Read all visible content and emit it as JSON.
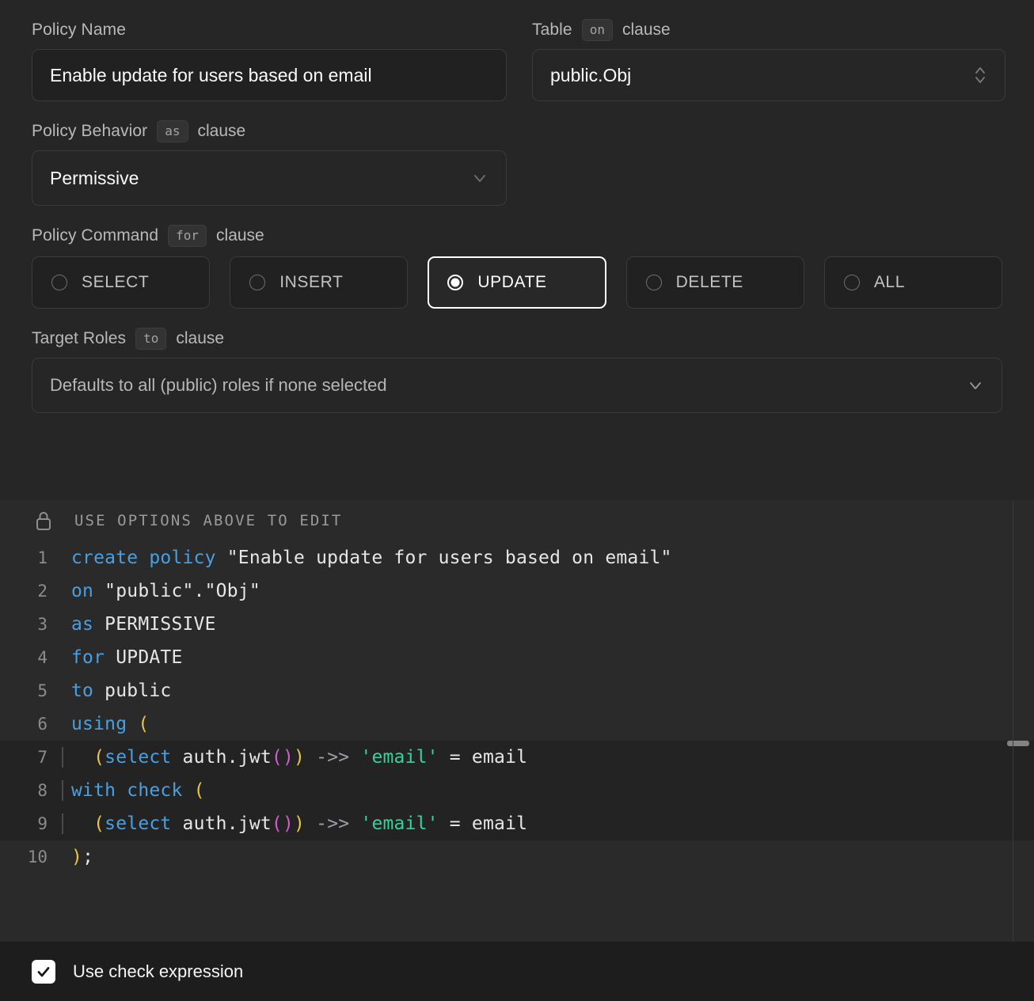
{
  "form": {
    "policy_name": {
      "label": "Policy Name",
      "value": "Enable update for users based on email",
      "placeholder": "Policy Name"
    },
    "table": {
      "label": "Table",
      "clause_badge": "on",
      "clause_word": "clause",
      "value": "public.Obj",
      "selector_icon": "selector-updown-icon"
    },
    "policy_behavior": {
      "label": "Policy Behavior",
      "clause_badge": "as",
      "clause_word": "clause",
      "value": "Permissive",
      "chevron_icon": "chevron-down-icon"
    },
    "policy_command": {
      "label": "Policy Command",
      "clause_badge": "for",
      "clause_word": "clause",
      "options": [
        {
          "label": "SELECT",
          "selected": false
        },
        {
          "label": "INSERT",
          "selected": false
        },
        {
          "label": "UPDATE",
          "selected": true
        },
        {
          "label": "DELETE",
          "selected": false
        },
        {
          "label": "ALL",
          "selected": false
        }
      ]
    },
    "target_roles": {
      "label": "Target Roles",
      "clause_badge": "to",
      "clause_word": "clause",
      "value": "Defaults to all (public) roles if none selected",
      "chevron_icon": "chevron-down-icon"
    }
  },
  "editor": {
    "lock_icon": "lock-icon",
    "banner": "USE OPTIONS ABOVE TO EDIT",
    "lines": [
      {
        "num": "1",
        "highlight": false,
        "text": "create policy \"Enable update for users based on email\""
      },
      {
        "num": "2",
        "highlight": false,
        "text": "on \"public\".\"Obj\""
      },
      {
        "num": "3",
        "highlight": false,
        "text": "as PERMISSIVE"
      },
      {
        "num": "4",
        "highlight": false,
        "text": "for UPDATE"
      },
      {
        "num": "5",
        "highlight": false,
        "text": "to public"
      },
      {
        "num": "6",
        "highlight": false,
        "text": "using ("
      },
      {
        "num": "7",
        "highlight": true,
        "text": "  (select auth.jwt()) ->> 'email' = email"
      },
      {
        "num": "8",
        "highlight": true,
        "text": "with check ("
      },
      {
        "num": "9",
        "highlight": true,
        "text": "  (select auth.jwt()) ->> 'email' = email"
      },
      {
        "num": "10",
        "highlight": false,
        "text": ");"
      }
    ]
  },
  "footer": {
    "checkbox_checked": true,
    "check_icon": "checkmark-icon",
    "label": "Use check expression"
  },
  "colors": {
    "form_bg": "#262626",
    "editor_bg": "#2a2a2a",
    "footer_bg": "#1d1d1d",
    "keyword": "#4a9fe0",
    "string": "#34d399",
    "paren_level1": "#e8c547",
    "paren_level2": "#d45ad4",
    "operator": "#9aa0a6",
    "selected_border": "#ffffff",
    "muted_text": "#b9b9b9"
  }
}
